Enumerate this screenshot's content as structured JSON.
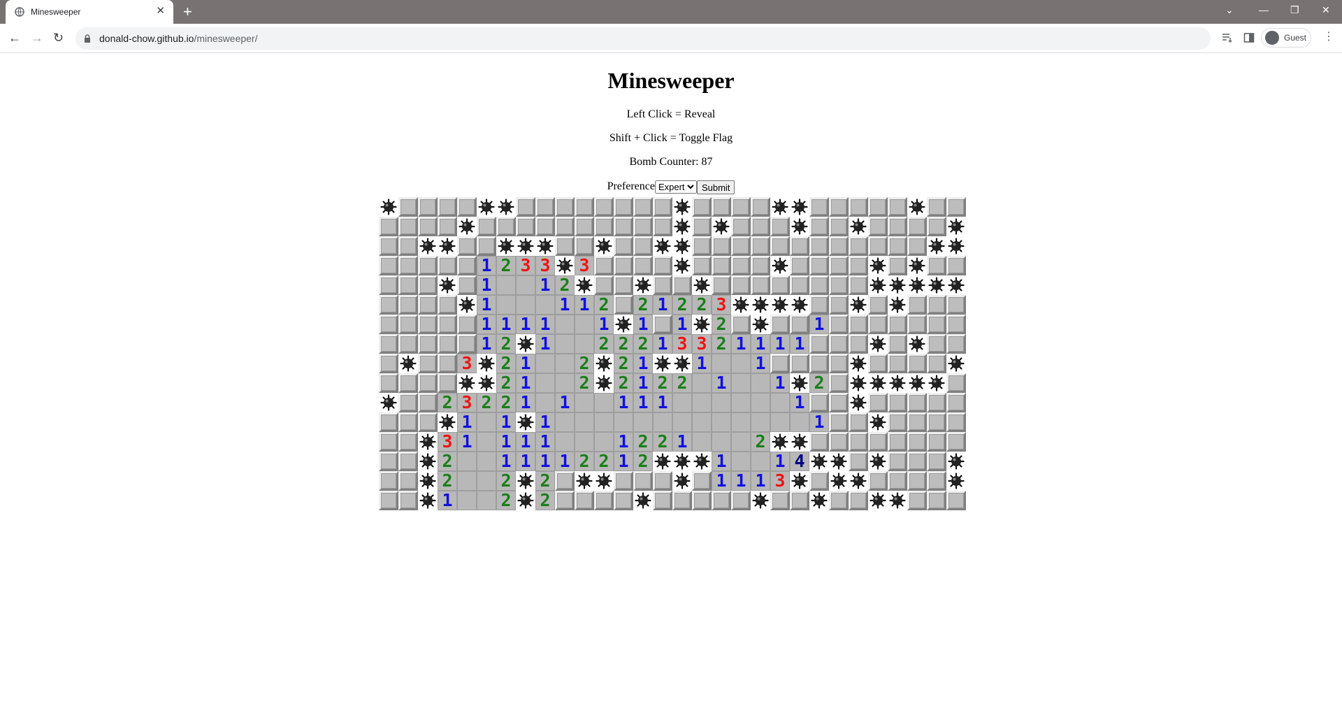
{
  "browser": {
    "tab_title": "Minesweeper",
    "url_host": "donald-chow.github.io",
    "url_path": "/minesweeper/",
    "profile_label": "Guest",
    "icons": [
      "globe-icon",
      "close-icon",
      "plus-icon",
      "back-icon",
      "forward-icon",
      "reload-icon",
      "lock-icon",
      "reading-list-icon",
      "side-panel-icon",
      "avatar-icon",
      "menu-icon"
    ]
  },
  "page": {
    "title": "Minesweeper",
    "instruction_reveal": "Left Click = Reveal",
    "instruction_flag": "Shift + Click = Toggle Flag",
    "bomb_counter_label": "Bomb Counter:",
    "bomb_counter_value": "87",
    "preference_label": "Preference",
    "preference_selected": "Expert",
    "submit_label": "Submit"
  },
  "board": {
    "legend": {
      "#": "hidden",
      "*": "mine",
      ".": "open-empty",
      "1-8": "open-number"
    },
    "rows": [
      "*####**########*####**#####*#####",
      "####*##########*#*###*##*####*#*#",
      "##**##***##*##**############***##",
      "#####1233*3####*####*####*#*#####",
      "###*#1..12*##*##*########*****",
      "####*1...112#21223****##*#*####",
      "#####1111..1*1#1*2#*##1#######",
      "#####12*1..22213321111###*#*###",
      "#*##3*21..2*21**1..1####*####*#",
      "####**21..2*2122 1..1*2#*****",
      "*##23221 1..111......1##*######",
      "###*1.1*1.............1##*####",
      "##*31.111...1221...2**########",
      "##*2..11112212***1..14**#*###*##",
      "##*2..2*2#**###*#1113*#**####*##",
      "##*1..2*2####*#####*##*##**####"
    ]
  }
}
